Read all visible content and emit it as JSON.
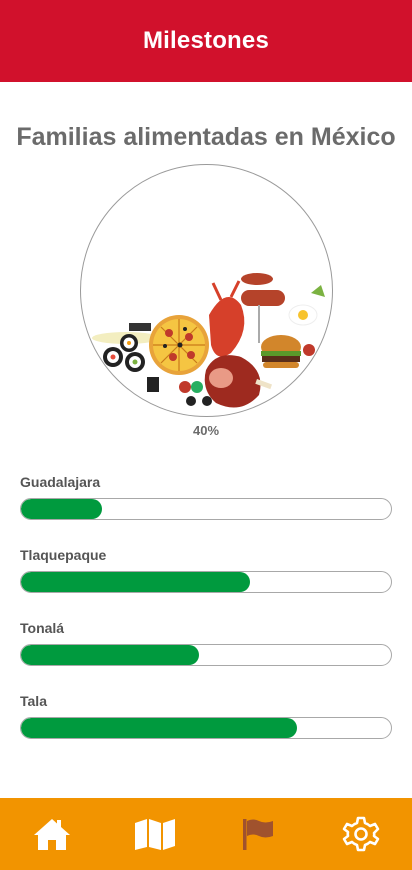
{
  "header": {
    "title": "Milestones"
  },
  "main": {
    "title": "Familias alimentadas en México",
    "progress_label": "40%",
    "progress_value": 0.4
  },
  "cities": [
    {
      "name": "Guadalajara",
      "progress": 0.22
    },
    {
      "name": "Tlaquepaque",
      "progress": 0.62
    },
    {
      "name": "Tonalá",
      "progress": 0.48
    },
    {
      "name": "Tala",
      "progress": 0.745
    }
  ],
  "nav": {
    "items": [
      {
        "icon": "home-icon",
        "active": false
      },
      {
        "icon": "map-icon",
        "active": false
      },
      {
        "icon": "flag-icon",
        "active": true
      },
      {
        "icon": "gear-icon",
        "active": false
      }
    ]
  },
  "colors": {
    "header_bg": "#d1112c",
    "nav_bg": "#f29400",
    "bar_fill": "#009a3e",
    "nav_icon": "#ffffff",
    "nav_icon_active": "#a0522d"
  }
}
